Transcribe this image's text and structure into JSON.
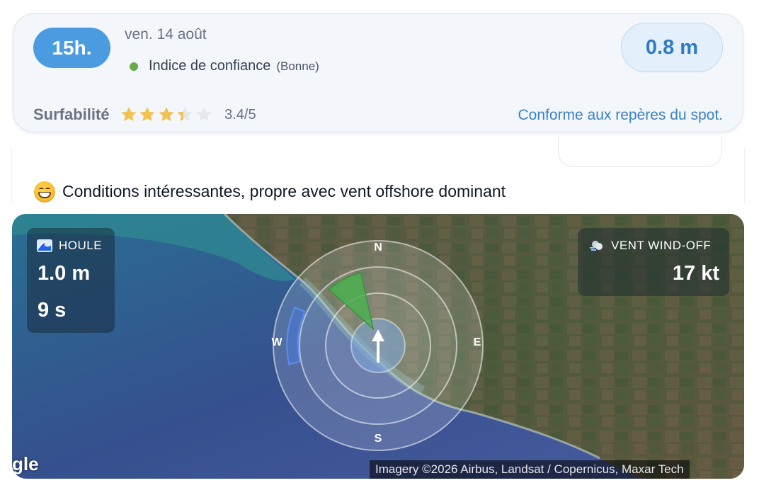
{
  "header": {
    "hour": "15h.",
    "date": "ven. 14 août",
    "confidence_label": "Indice de confiance",
    "confidence_value": "(Bonne)",
    "confidence_color": "#6aa84f",
    "wave_height": "0.8 m",
    "surfability_label": "Surfabilité",
    "surfability_rating": "3.4/5",
    "stars_fraction": 0.68,
    "conformity_text": "Conforme aux repères du spot."
  },
  "message": {
    "emoji": "grinning-face",
    "text": "Conditions intéressantes, propre avec vent offshore dominant"
  },
  "map": {
    "swell": {
      "icon": "wave-icon",
      "label": "HOULE",
      "height": "1.0 m",
      "period": "9 s"
    },
    "wind": {
      "icon": "wind-icon",
      "label": "VENT WIND-OFF",
      "speed": "17 kt"
    },
    "compass": {
      "north": "N",
      "south": "S",
      "east": "E",
      "west": "W"
    },
    "credit": "Imagery ©2026 Airbus, Landsat / Copernicus, Maxar Tech",
    "google_fragment": "gle"
  },
  "colors": {
    "accent": "#4a9bdf",
    "height_text": "#2f7ac7",
    "link": "#3b82c4",
    "star": "#f2c14e",
    "swell_sector": "#4a78d8",
    "wind_sector": "#4caf50"
  }
}
